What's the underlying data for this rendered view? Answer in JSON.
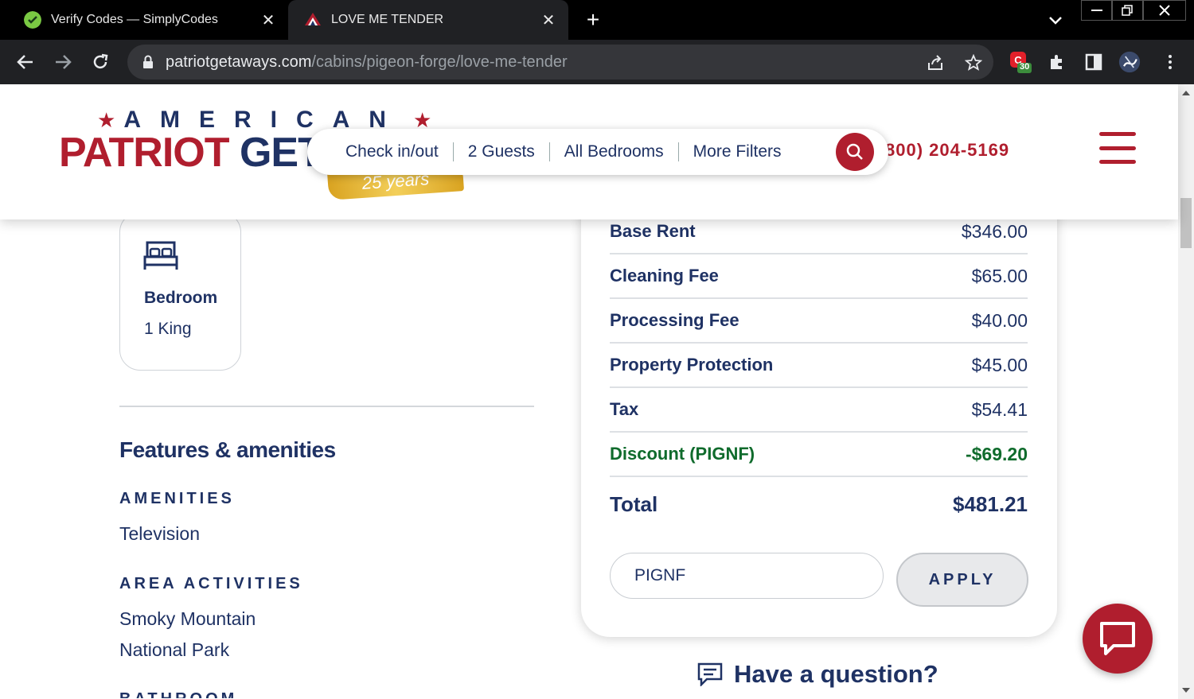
{
  "browser": {
    "tabs": [
      {
        "title": "Verify Codes — SimplyCodes",
        "active": false
      },
      {
        "title": "LOVE ME TENDER",
        "active": true
      }
    ],
    "url": {
      "domain": "patriotgetaways.com",
      "path": "/cabins/pigeon-forge/love-me-tender"
    },
    "extension_badge": "30"
  },
  "header": {
    "logo_top": "AMERICAN",
    "logo_main_red": "PATRIOT ",
    "logo_main_blue": "GET/",
    "ribbon": "25 years",
    "search": {
      "check": "Check in/out",
      "guests": "2 Guests",
      "bedrooms": "All Bedrooms",
      "filters": "More Filters"
    },
    "phone": "800) 204-5169"
  },
  "bedroom": {
    "label": "Bedroom",
    "value": "1 King"
  },
  "features": {
    "heading": "Features & amenities",
    "amenities_label": "AMENITIES",
    "amenities": [
      "Television"
    ],
    "activities_label": "AREA ACTIVITIES",
    "activities": [
      "Smoky Mountain",
      "National Park"
    ],
    "next_label": "BATHROOM"
  },
  "pricing": {
    "rows": [
      {
        "label": "Base Rent",
        "value": "$346.00"
      },
      {
        "label": "Cleaning Fee",
        "value": "$65.00"
      },
      {
        "label": "Processing Fee",
        "value": "$40.00"
      },
      {
        "label": "Property Protection",
        "value": "$45.00"
      },
      {
        "label": "Tax",
        "value": "$54.41"
      },
      {
        "label": "Discount (PIGNF)",
        "value": "-$69.20"
      }
    ],
    "total_label": "Total",
    "total_value": "$481.21",
    "promo_value": "PIGNF",
    "apply_label": "APPLY"
  },
  "help": {
    "question": "Have a question?"
  },
  "colors": {
    "brand_red": "#b01e2e",
    "brand_navy": "#1f3264",
    "discount_green": "#0f6b2c"
  }
}
